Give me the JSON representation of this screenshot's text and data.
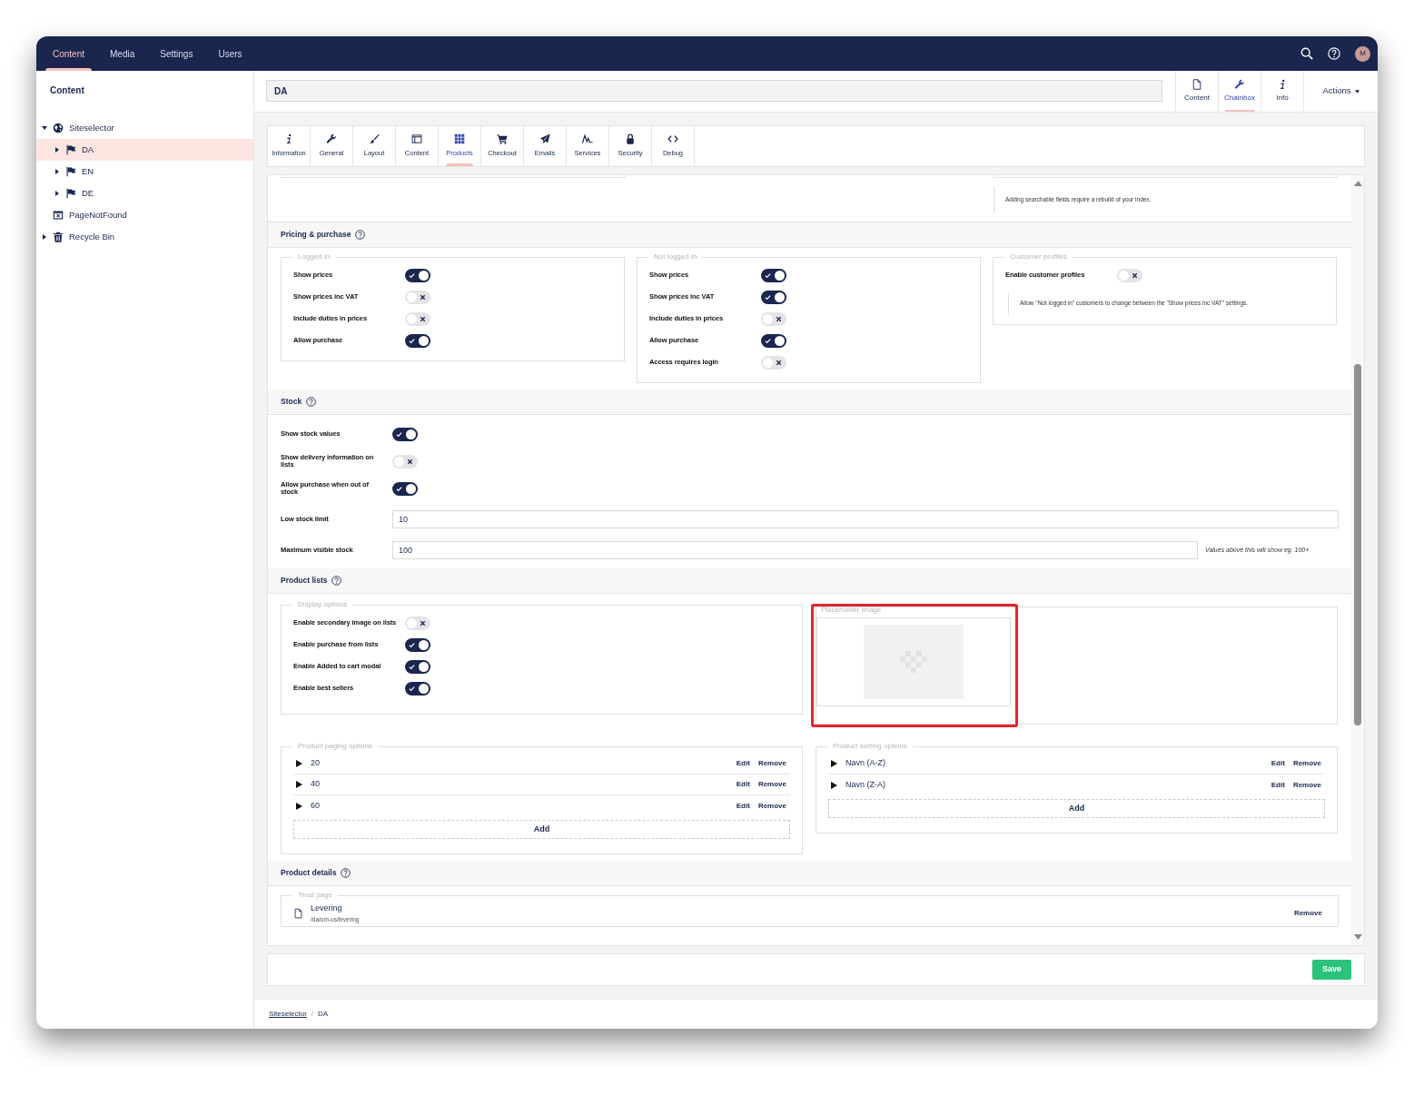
{
  "top_nav": {
    "sections": [
      {
        "label": "Content",
        "selected": true
      },
      {
        "label": "Media",
        "selected": false
      },
      {
        "label": "Settings",
        "selected": false
      },
      {
        "label": "Users",
        "selected": false
      }
    ],
    "user_initial": "M"
  },
  "tree": {
    "title": "Content",
    "items": [
      {
        "label": "Siteselector",
        "kind": "globe",
        "selected": false,
        "expanded": true,
        "children": [
          {
            "label": "DA",
            "kind": "flag",
            "selected": true,
            "expanded": false
          },
          {
            "label": "EN",
            "kind": "flag",
            "selected": false,
            "expanded": false
          },
          {
            "label": "DE",
            "kind": "flag",
            "selected": false,
            "expanded": false
          }
        ]
      },
      {
        "label": "PageNotFound",
        "kind": "page-x",
        "selected": false
      },
      {
        "label": "Recycle Bin",
        "kind": "bin",
        "selected": false,
        "expanded": false
      }
    ]
  },
  "editor": {
    "name": "DA",
    "apps": [
      {
        "label": "Content",
        "kind": "file",
        "selected": false
      },
      {
        "label": "Chainbox",
        "kind": "wrench",
        "selected": true
      },
      {
        "label": "Info",
        "kind": "info",
        "selected": false
      }
    ],
    "actions": "Actions"
  },
  "tabs": [
    {
      "label": "Information",
      "kind": "info",
      "selected": false
    },
    {
      "label": "General",
      "kind": "wrench",
      "selected": false
    },
    {
      "label": "Layout",
      "kind": "brush",
      "selected": false
    },
    {
      "label": "Content",
      "kind": "window",
      "selected": false
    },
    {
      "label": "Products",
      "kind": "grid",
      "selected": true
    },
    {
      "label": "Checkout",
      "kind": "cart",
      "selected": false
    },
    {
      "label": "Emails",
      "kind": "plane",
      "selected": false
    },
    {
      "label": "Services",
      "kind": "wave",
      "selected": false
    },
    {
      "label": "Security",
      "kind": "lock",
      "selected": false
    },
    {
      "label": "Debug",
      "kind": "code",
      "selected": false
    }
  ],
  "search_note": "Adding searchable fields require a rebuild of your index.",
  "pricing": {
    "title": "Pricing & purchase",
    "groups": [
      {
        "legend": "Logged in",
        "toggles": [
          {
            "label": "Show prices",
            "on": true
          },
          {
            "label": "Show prices inc VAT",
            "on": false
          },
          {
            "label": "Include duties in prices",
            "on": false
          },
          {
            "label": "Allow purchase",
            "on": true
          }
        ]
      },
      {
        "legend": "Not logged in",
        "toggles": [
          {
            "label": "Show prices",
            "on": true
          },
          {
            "label": "Show prices inc VAT",
            "on": true
          },
          {
            "label": "Include duties in prices",
            "on": false
          },
          {
            "label": "Allow purchase",
            "on": true
          },
          {
            "label": "Access requires login",
            "on": false
          }
        ]
      },
      {
        "legend": "Customer profiles",
        "toggles": [
          {
            "label": "Enable customer profiles",
            "on": false
          }
        ],
        "note": "Allow \"Not logged in\" customers to change between the \"Show prices inc VAT\" settings."
      }
    ]
  },
  "stock": {
    "title": "Stock",
    "toggles": [
      {
        "label": "Show stock values",
        "on": true
      },
      {
        "label": "Show delivery information on lists",
        "on": false
      },
      {
        "label": "Allow purchase when out of stock",
        "on": true
      }
    ],
    "fields": [
      {
        "label": "Low stock limit",
        "value": "10"
      },
      {
        "label": "Maximum visible stock",
        "value": "100",
        "hint": "Values above this will show eg. 100+"
      }
    ]
  },
  "product_lists": {
    "title": "Product lists",
    "display_options": {
      "legend": "Display options",
      "toggles": [
        {
          "label": "Enable secondary image on lists",
          "on": false
        },
        {
          "label": "Enable purchase from lists",
          "on": true
        },
        {
          "label": "Enable Added to cart modal",
          "on": true
        },
        {
          "label": "Enable best sellers",
          "on": true
        }
      ]
    },
    "placeholder_image": {
      "legend": "Placeholder image",
      "highlighted": true
    },
    "paging": {
      "legend": "Product paging options",
      "items": [
        {
          "label": "20",
          "edit": "Edit",
          "remove": "Remove"
        },
        {
          "label": "40",
          "edit": "Edit",
          "remove": "Remove"
        },
        {
          "label": "60",
          "edit": "Edit",
          "remove": "Remove"
        }
      ],
      "add": "Add"
    },
    "sorting": {
      "legend": "Product sorting options",
      "items": [
        {
          "label": "Navn (A-Z)",
          "edit": "Edit",
          "remove": "Remove"
        },
        {
          "label": "Navn (Z-A)",
          "edit": "Edit",
          "remove": "Remove"
        }
      ],
      "add": "Add"
    }
  },
  "product_details": {
    "title": "Product details",
    "trust_page": {
      "legend": "Trust page",
      "name": "Levering",
      "path": "/da/om-os/levering",
      "remove": "Remove"
    }
  },
  "save": "Save",
  "breadcrumb": {
    "items": [
      "Siteselector",
      "DA"
    ],
    "separator": "/"
  }
}
